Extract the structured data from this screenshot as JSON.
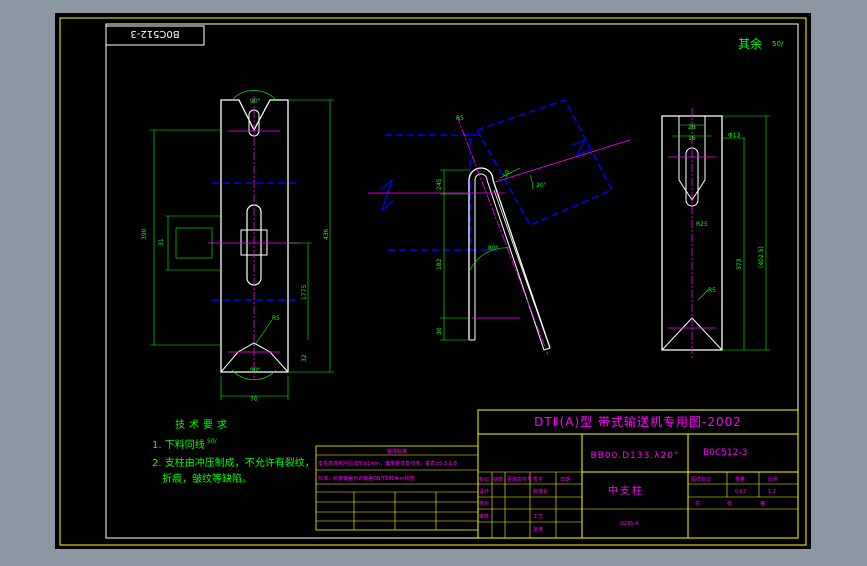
{
  "drawing": {
    "stamp_code": "B0C512-3",
    "surface_note": "其余",
    "surface_symbol": "50/",
    "tech_title": "技术要求",
    "tech_req_1": "1. 下料同线",
    "tech_req_1_symbol": "50/",
    "tech_req_2": "2. 支柱由冲压制成，不允许有裂纹，",
    "tech_req_3": "折痕，皱纹等缺陷。",
    "title_main": "DTⅡ(A)型  带式输送机专用图-2002",
    "spec_code": "BB00.D133.λ20°",
    "drawing_no": "B0C512-3",
    "part_name": "中支柱",
    "stage_label": "图样标记",
    "weight_label": "重量",
    "scale_label": "比例",
    "weight_value": "0.67",
    "scale_value": "1:2",
    "sheet_label": "共",
    "sheet_of_label": "张",
    "sheet_no_label": "第",
    "mark_label": "标记",
    "count_label": "处数",
    "doc_label": "更改文件号",
    "sign_label": "签字",
    "date_label": "日期",
    "design_label": "设计",
    "check_label": "校对",
    "approve_label": "审核",
    "std_label": "标准化",
    "craft_label": "工艺",
    "ratify_label": "批准",
    "material_label": "Q235-A"
  },
  "table": {
    "title": "轴测标准",
    "row1": "支柱高度用冲压成形±1mm，偏离整体直线度，垂直±0.5:1.8",
    "row2": "标准，长度偏差允许偏差GB/T1804-m线性"
  },
  "dims": {
    "d90_top": "90°",
    "d90_bottom": "90°",
    "d70": "70",
    "d390": "390",
    "d436": "436",
    "d31": "31",
    "d1775": "1775",
    "d32": "32",
    "dR5": "R5",
    "d85": "R5",
    "d245": "245",
    "d182": "182",
    "d30": "30",
    "d10": "10",
    "d20deg": "20°",
    "d80deg": "80°",
    "d28": "28",
    "d16": "16",
    "d2": "2",
    "dR25": "R25",
    "d373": "373",
    "d4025": "(402.5)",
    "dphi": "Φ13"
  }
}
